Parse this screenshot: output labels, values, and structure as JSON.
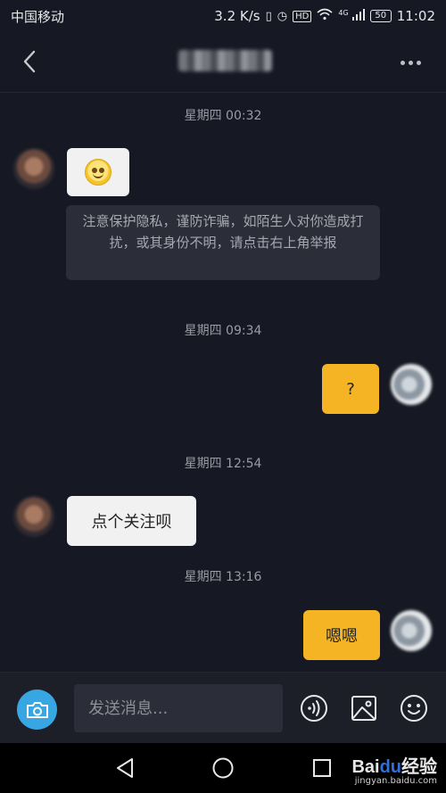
{
  "status_bar": {
    "carrier": "中国移动",
    "speed": "3.2 K/s",
    "hd": "HD",
    "network": "4G",
    "battery": "50",
    "time": "11:02"
  },
  "header": {
    "back_icon": "chevron-left-icon",
    "more_icon": "more-dots-icon"
  },
  "messages": [
    {
      "timestamp": "星期四 00:32"
    },
    {
      "side": "left",
      "type": "emoji",
      "emoji": "smiley-face"
    },
    {
      "notice": "注意保护隐私，谨防诈骗，如陌生人对你造成打扰，或其身份不明，请点击右上角举报"
    },
    {
      "timestamp": "星期四 09:34"
    },
    {
      "side": "right",
      "text": "?"
    },
    {
      "timestamp": "星期四 12:54"
    },
    {
      "side": "left",
      "text": "点个关注呗"
    },
    {
      "timestamp": "星期四 13:16"
    },
    {
      "side": "right",
      "text": "嗯嗯"
    }
  ],
  "input_bar": {
    "placeholder": "发送消息...",
    "camera_icon": "camera-icon",
    "voice_icon": "voice-icon",
    "image_icon": "image-icon",
    "emoji_icon": "emoji-icon"
  },
  "watermark": {
    "main": "Bai",
    "paw": "du",
    "suffix": "经验",
    "sub": "jingyan.baidu.com"
  },
  "colors": {
    "background": "#161823",
    "bubble_right": "#f4b424",
    "bubble_left": "#f1f1f1",
    "accent_blue": "#39a6e4"
  }
}
